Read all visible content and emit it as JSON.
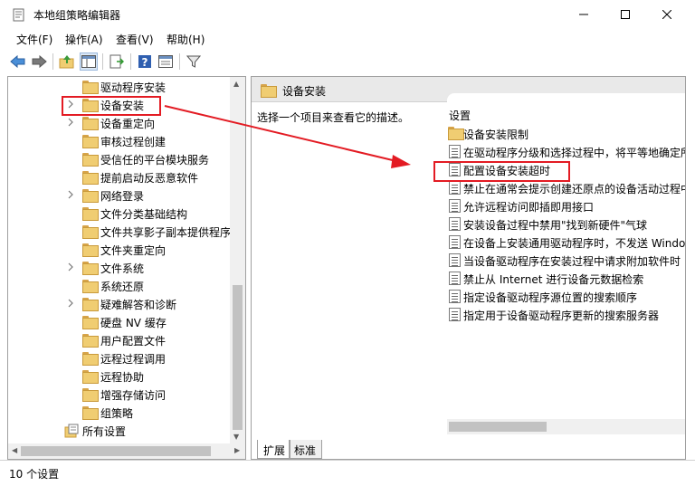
{
  "window": {
    "title": "本地组策略编辑器",
    "controls": [
      "minimize",
      "maximize",
      "close"
    ]
  },
  "menubar": {
    "items": [
      "文件(F)",
      "操作(A)",
      "查看(V)",
      "帮助(H)"
    ]
  },
  "toolbar": {
    "icons": [
      "back-icon",
      "forward-icon",
      "up-folder-icon",
      "show-hide-tree-icon",
      "export-list-icon",
      "help-icon",
      "properties-icon",
      "filter-icon"
    ]
  },
  "tree": {
    "items": [
      {
        "label": "驱动程序安装",
        "expandable": false
      },
      {
        "label": "设备安装",
        "expandable": true,
        "selected": true
      },
      {
        "label": "设备重定向",
        "expandable": true
      },
      {
        "label": "审核过程创建",
        "expandable": false
      },
      {
        "label": "受信任的平台模块服务",
        "expandable": false
      },
      {
        "label": "提前启动反恶意软件",
        "expandable": false
      },
      {
        "label": "网络登录",
        "expandable": true
      },
      {
        "label": "文件分类基础结构",
        "expandable": false
      },
      {
        "label": "文件共享影子副本提供程序",
        "expandable": false
      },
      {
        "label": "文件夹重定向",
        "expandable": false
      },
      {
        "label": "文件系统",
        "expandable": true
      },
      {
        "label": "系统还原",
        "expandable": false
      },
      {
        "label": "疑难解答和诊断",
        "expandable": true
      },
      {
        "label": "硬盘 NV 缓存",
        "expandable": false
      },
      {
        "label": "用户配置文件",
        "expandable": false
      },
      {
        "label": "远程过程调用",
        "expandable": false
      },
      {
        "label": "远程协助",
        "expandable": false
      },
      {
        "label": "增强存储访问",
        "expandable": false
      },
      {
        "label": "组策略",
        "expandable": false
      }
    ],
    "all_settings_label": "所有设置"
  },
  "right_pane": {
    "header_title": "设备安装",
    "description": "选择一个项目来查看它的描述。",
    "column_header": "设置",
    "folder_item": "设备安装限制",
    "policies": [
      "在驱动程序分级和选择过程中，将平等地确定所",
      "配置设备安装超时",
      "禁止在通常会提示创建还原点的设备活动过程中",
      "允许远程访问即插即用接口",
      "安装设备过程中禁用\"找到新硬件\"气球",
      "在设备上安装通用驱动程序时，不发送 Windo",
      "当设备驱动程序在安装过程中请求附加软件时",
      "禁止从 Internet 进行设备元数据检索",
      "指定设备驱动程序源位置的搜索顺序",
      "指定用于设备驱动程序更新的搜索服务器"
    ]
  },
  "tabs": [
    "扩展",
    "标准"
  ],
  "status": {
    "text": "10 个设置"
  },
  "colors": {
    "highlight_box": "#e31b23",
    "header_bg": "#e9e9e9",
    "folder": "#f0cd72"
  }
}
